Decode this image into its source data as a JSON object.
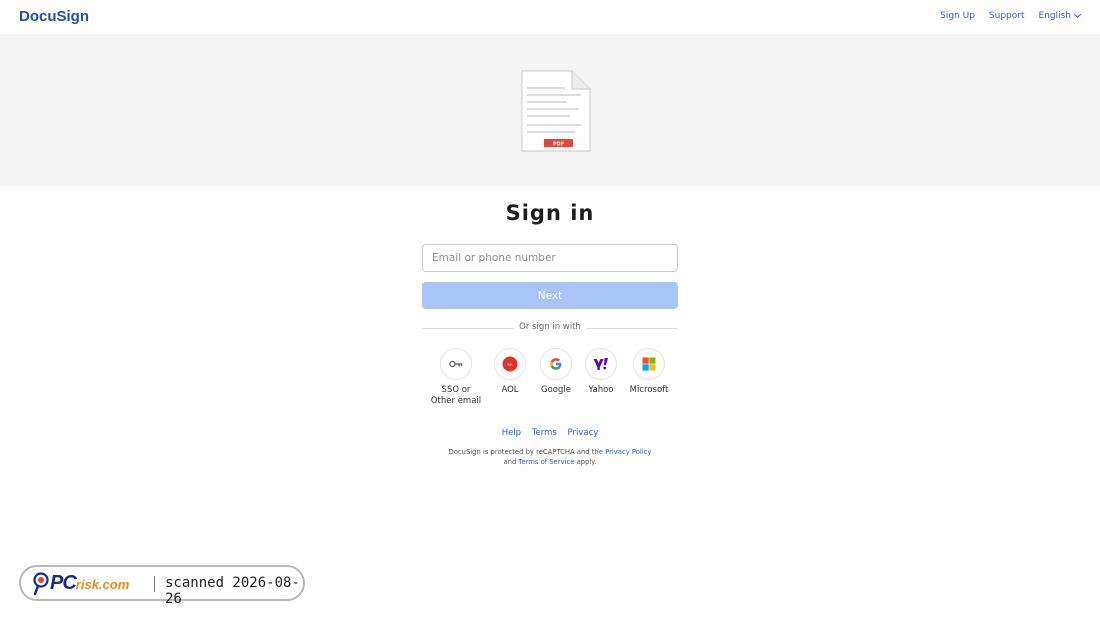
{
  "header": {
    "logo": "DocuSign",
    "nav": [
      "Sign Up",
      "Support"
    ],
    "language": "English"
  },
  "hero": {
    "document_badge": "PDF",
    "document_icon": "pdf-document-icon"
  },
  "signin": {
    "title": "Sign in",
    "email_placeholder": "Email or phone number",
    "next_label": "Next",
    "divider_text": "Or sign in with",
    "providers": [
      {
        "label_line1": "SSO or",
        "label_line2": "Other email",
        "icon": "key-icon"
      },
      {
        "label_line1": "AOL",
        "label_line2": "",
        "icon": "aol-icon"
      },
      {
        "label_line1": "Google",
        "label_line2": "",
        "icon": "google-icon"
      },
      {
        "label_line1": "Yahoo",
        "label_line2": "",
        "icon": "yahoo-icon"
      },
      {
        "label_line1": "Microsoft",
        "label_line2": "",
        "icon": "microsoft-icon"
      }
    ],
    "aol_badge": "Aol."
  },
  "footer": {
    "links": [
      "Help",
      "Terms",
      "Privacy"
    ],
    "legal_prefix": "DocuSign is protected by reCAPTCHA and the",
    "legal_privacy": "Privacy Policy",
    "legal_and": "and",
    "legal_terms": "Terms of Service",
    "legal_suffix": "apply."
  },
  "watermark": {
    "brand_main": "PC",
    "brand_suffix": "risk.com",
    "scanned_text": "scanned 2026-08-26"
  },
  "colors": {
    "link": "#2a5bd7",
    "logo": "#1f4fa8",
    "next_button": "#a9c4f7",
    "hero_bg": "#f4f4f4",
    "pdf_red": "#e2463a"
  }
}
